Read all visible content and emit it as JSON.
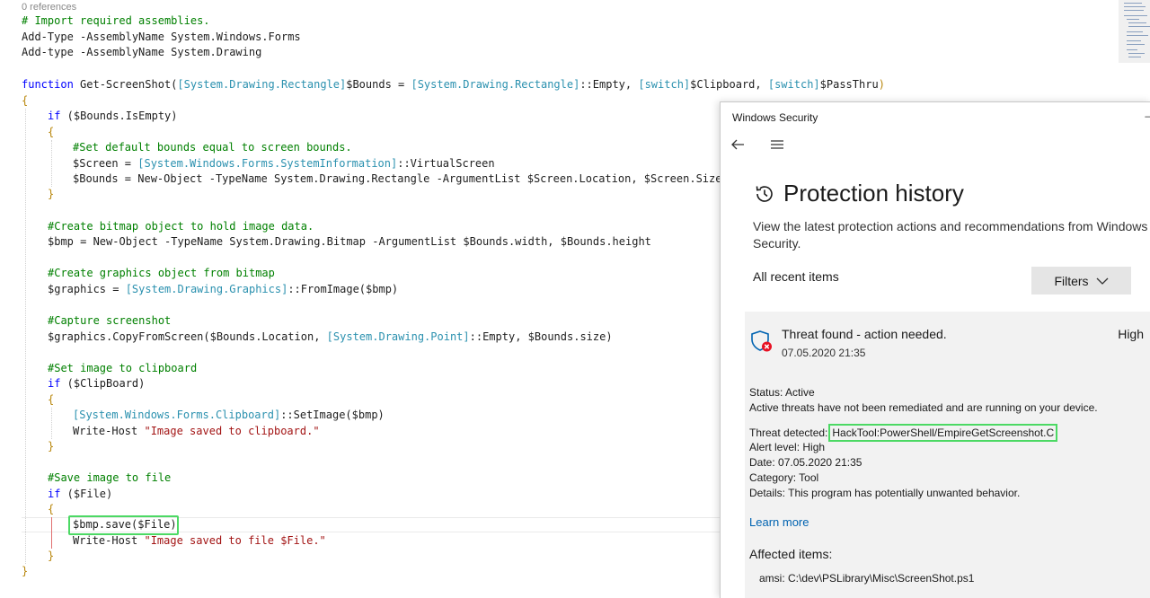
{
  "editor": {
    "references": "0 references",
    "lines": {
      "l1": "# Import required assemblies.",
      "l2": "Add-Type -AssemblyName System.Windows.Forms",
      "l3": "Add-type -AssemblyName System.Drawing",
      "fn_kw": "function",
      "fn_name": " Get-ScreenShot(",
      "fn_t1": "[System.Drawing.Rectangle]",
      "fn_p1": "$Bounds = ",
      "fn_t2": "[System.Drawing.Rectangle]",
      "fn_p2": "::Empty, ",
      "fn_t3": "[switch]",
      "fn_p3": "$Clipboard, ",
      "fn_t4": "[switch]",
      "fn_p4": "$PassThru",
      "fn_close": ")",
      "open_brace": "{",
      "close_brace": "}",
      "if1_kw": "if",
      "if1_rest": " ($Bounds.IsEmpty)",
      "c_default": "#Set default bounds equal to screen bounds.",
      "screen_a": "$Screen = ",
      "screen_t": "[System.Windows.Forms.SystemInformation]",
      "screen_b": "::VirtualScreen",
      "bounds_new": "$Bounds = New-Object -TypeName System.Drawing.Rectangle -ArgumentList $Screen.Location, $Screen.Size",
      "c_bitmap": "#Create bitmap object to hold image data.",
      "bmp_new": "$bmp = New-Object -TypeName System.Drawing.Bitmap -ArgumentList $Bounds.width, $Bounds.height",
      "c_graphics": "#Create graphics object from bitmap",
      "gfx_a": "$graphics = ",
      "gfx_t": "[System.Drawing.Graphics]",
      "gfx_b": "::FromImage($bmp)",
      "c_capture": "#Capture screenshot",
      "copy_a": "$graphics.CopyFromScreen($Bounds.Location, ",
      "copy_t": "[System.Drawing.Point]",
      "copy_b": "::Empty, $Bounds.size)",
      "c_clip": "#Set image to clipboard",
      "if2_kw": "if",
      "if2_rest": " ($ClipBoard)",
      "clip_t": "[System.Windows.Forms.Clipboard]",
      "clip_b": "::SetImage($bmp)",
      "wh1_a": "Write-Host ",
      "wh1_s": "\"Image saved to clipboard.\"",
      "c_save": "#Save image to file",
      "if3_kw": "if",
      "if3_rest": " ($File)",
      "save_a": "$bmp.save",
      "save_p": "(",
      "save_b": "$File",
      "save_c": ")",
      "wh2_a": "Write-Host ",
      "wh2_s": "\"Image saved to file $File.\""
    }
  },
  "security": {
    "window_title": "Windows Security",
    "minimize": "–",
    "back_icon": "back-arrow-icon",
    "menu_icon": "hamburger-menu-icon",
    "page_title": "Protection history",
    "description": "View the latest protection actions and recommendations from Windows Security.",
    "recent_label": "All recent items",
    "filters_label": "Filters",
    "threat": {
      "title": "Threat found - action needed.",
      "date": "07.05.2020 21:35",
      "severity": "High",
      "status_label": "Status:",
      "status_value": "Active",
      "status_detail": "Active threats have not been remediated and are running on your device.",
      "detected_label": "Threat detected:",
      "detected_value": "HackTool:PowerShell/EmpireGetScreenshot.C",
      "alert_label": "Alert level:",
      "alert_value": "High",
      "date_label": "Date:",
      "date_value": "07.05.2020 21:35",
      "category_label": "Category:",
      "category_value": "Tool",
      "details_label": "Details:",
      "details_value": "This program has potentially unwanted behavior.",
      "learn_more": "Learn more",
      "affected_heading": "Affected items:",
      "affected_value": "amsi: C:\\dev\\PSLibrary\\Misc\\ScreenShot.ps1"
    },
    "colors": {
      "highlight": "#4cd964",
      "link": "#0063b1",
      "card_bg": "#f2f2f2",
      "threat_red": "#e81123"
    }
  }
}
